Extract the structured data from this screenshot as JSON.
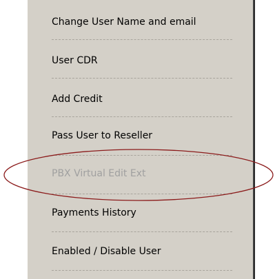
{
  "menu": {
    "items": [
      {
        "label": "Change User Name and email",
        "enabled": true
      },
      {
        "label": "User CDR",
        "enabled": true
      },
      {
        "label": "Add Credit",
        "enabled": true
      },
      {
        "label": "Pass User to Reseller",
        "enabled": true
      },
      {
        "label": "PBX Virtual Edit Ext",
        "enabled": false
      },
      {
        "label": "Payments History",
        "enabled": true
      },
      {
        "label": "Enabled / Disable User",
        "enabled": true
      }
    ]
  },
  "colors": {
    "menu_background": "#d4d0c8",
    "disabled_text": "#a0a0a0",
    "highlight_ellipse": "#8b1a1a"
  }
}
